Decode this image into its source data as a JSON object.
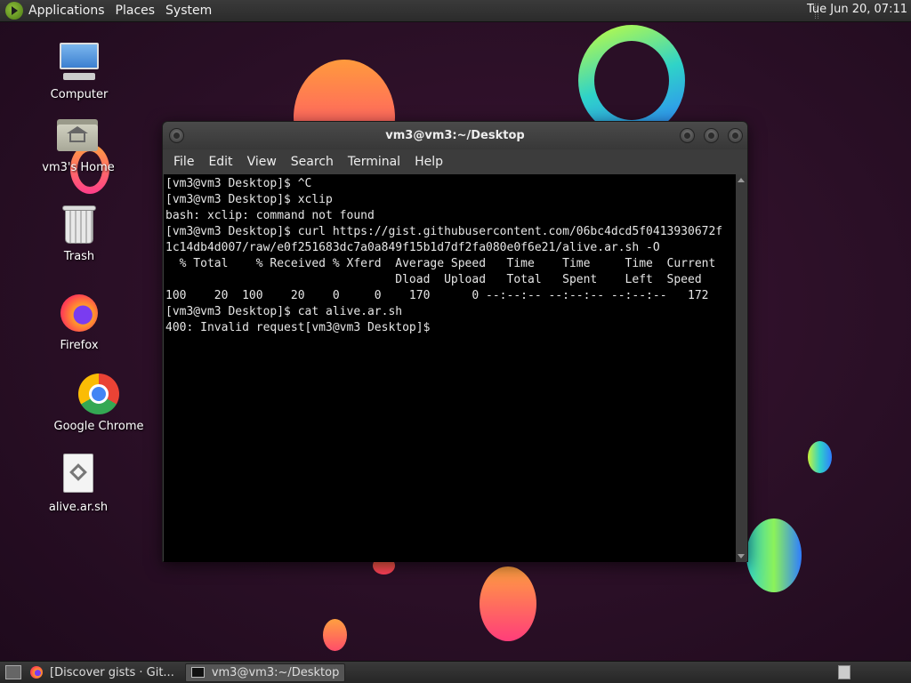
{
  "top_panel": {
    "menus": [
      "Applications",
      "Places",
      "System"
    ],
    "clock": "Tue Jun 20, 07:11"
  },
  "desktop_icons": [
    {
      "label": "Computer",
      "icon": "computer-icon"
    },
    {
      "label": "vm3's Home",
      "icon": "home-folder-icon"
    },
    {
      "label": "Trash",
      "icon": "trash-icon"
    },
    {
      "label": "Firefox",
      "icon": "firefox-icon"
    },
    {
      "label": "Google Chrome",
      "icon": "chrome-icon"
    },
    {
      "label": "alive.ar.sh",
      "icon": "script-file-icon"
    }
  ],
  "terminal": {
    "title": "vm3@vm3:~/Desktop",
    "menus": [
      "File",
      "Edit",
      "View",
      "Search",
      "Terminal",
      "Help"
    ],
    "lines": [
      "[vm3@vm3 Desktop]$ ^C",
      "[vm3@vm3 Desktop]$ xclip",
      "bash: xclip: command not found",
      "[vm3@vm3 Desktop]$ curl https://gist.githubusercontent.com/06bc4dcd5f0413930672f",
      "1c14db4d007/raw/e0f251683dc7a0a849f15b1d7df2fa080e0f6e21/alive.ar.sh -O",
      "  % Total    % Received % Xferd  Average Speed   Time    Time     Time  Current",
      "                                 Dload  Upload   Total   Spent    Left  Speed",
      "100    20  100    20    0     0    170      0 --:--:-- --:--:-- --:--:--   172",
      "[vm3@vm3 Desktop]$ cat alive.ar.sh",
      "400: Invalid request[vm3@vm3 Desktop]$ "
    ]
  },
  "taskbar": {
    "tasks": [
      {
        "label": "[Discover gists · Git...",
        "icon": "firefox-icon",
        "active": false
      },
      {
        "label": "vm3@vm3:~/Desktop",
        "icon": "terminal-icon",
        "active": true
      }
    ]
  },
  "colors": {
    "desktop_bg": "#2a0f26",
    "panel_bg": "#333333",
    "terminal_bg": "#000000",
    "terminal_fg": "#e6e6e6"
  }
}
